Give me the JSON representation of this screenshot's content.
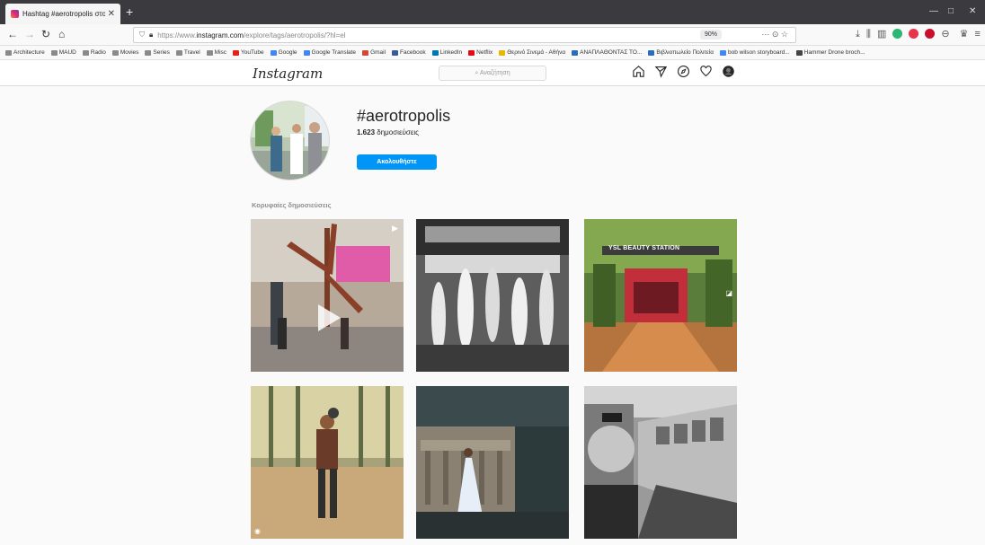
{
  "browser": {
    "tab_title": "Hashtag #aerotropolis στο Ins",
    "tab_close": "✕",
    "new_tab": "+",
    "url_prefix": "https://www.",
    "url_host": "instagram.com",
    "url_path": "/explore/tags/aerotropolis/?hl=el",
    "zoom": "90%",
    "page_actions": "··· ⊙ ☆",
    "bookmarks": [
      {
        "label": "Architecture",
        "color": "#8a8a8a"
      },
      {
        "label": "MAUD",
        "color": "#8a8a8a"
      },
      {
        "label": "Radio",
        "color": "#8a8a8a"
      },
      {
        "label": "Movies",
        "color": "#8a8a8a"
      },
      {
        "label": "Series",
        "color": "#8a8a8a"
      },
      {
        "label": "Travel",
        "color": "#8a8a8a"
      },
      {
        "label": "Misc",
        "color": "#8a8a8a"
      },
      {
        "label": "YouTube",
        "color": "#e62117"
      },
      {
        "label": "Google",
        "color": "#4285f4"
      },
      {
        "label": "Google Translate",
        "color": "#4285f4"
      },
      {
        "label": "Gmail",
        "color": "#d44638"
      },
      {
        "label": "Facebook",
        "color": "#3b5998"
      },
      {
        "label": "LinkedIn",
        "color": "#0077b5"
      },
      {
        "label": "Netflix",
        "color": "#e50914"
      },
      {
        "label": "Θερινό Σινεμά - Αθήνα",
        "color": "#e8b800"
      },
      {
        "label": "ΑΝΑΠΛΑΘΟΝΤΑΣ ΤΟ...",
        "color": "#2a6ebb"
      },
      {
        "label": "Βιβλιοπωλείο Πολιτεία",
        "color": "#2a6ebb"
      },
      {
        "label": "bob wilson storyboard...",
        "color": "#4285f4"
      },
      {
        "label": "Hammer Drone broch...",
        "color": "#444444"
      }
    ]
  },
  "instagram": {
    "logo": "Instagram",
    "search_placeholder": "Αναζήτηση",
    "hashtag": "#aerotropolis",
    "post_count_number": "1.623",
    "post_count_label": "δημοσιεύσεις",
    "follow_label": "Ακολουθήστε",
    "top_posts_label": "Κορυφαίες δημοσιεύσεις",
    "posts": [
      {
        "kind": "video"
      },
      {
        "kind": "photo"
      },
      {
        "kind": "carousel",
        "sign_text": "YSL BEAUTY STATION"
      },
      {
        "kind": "photo"
      },
      {
        "kind": "photo"
      },
      {
        "kind": "photo"
      }
    ]
  },
  "colors": {
    "accent": "#0095f6",
    "browser_dark": "#3b3b3f"
  }
}
